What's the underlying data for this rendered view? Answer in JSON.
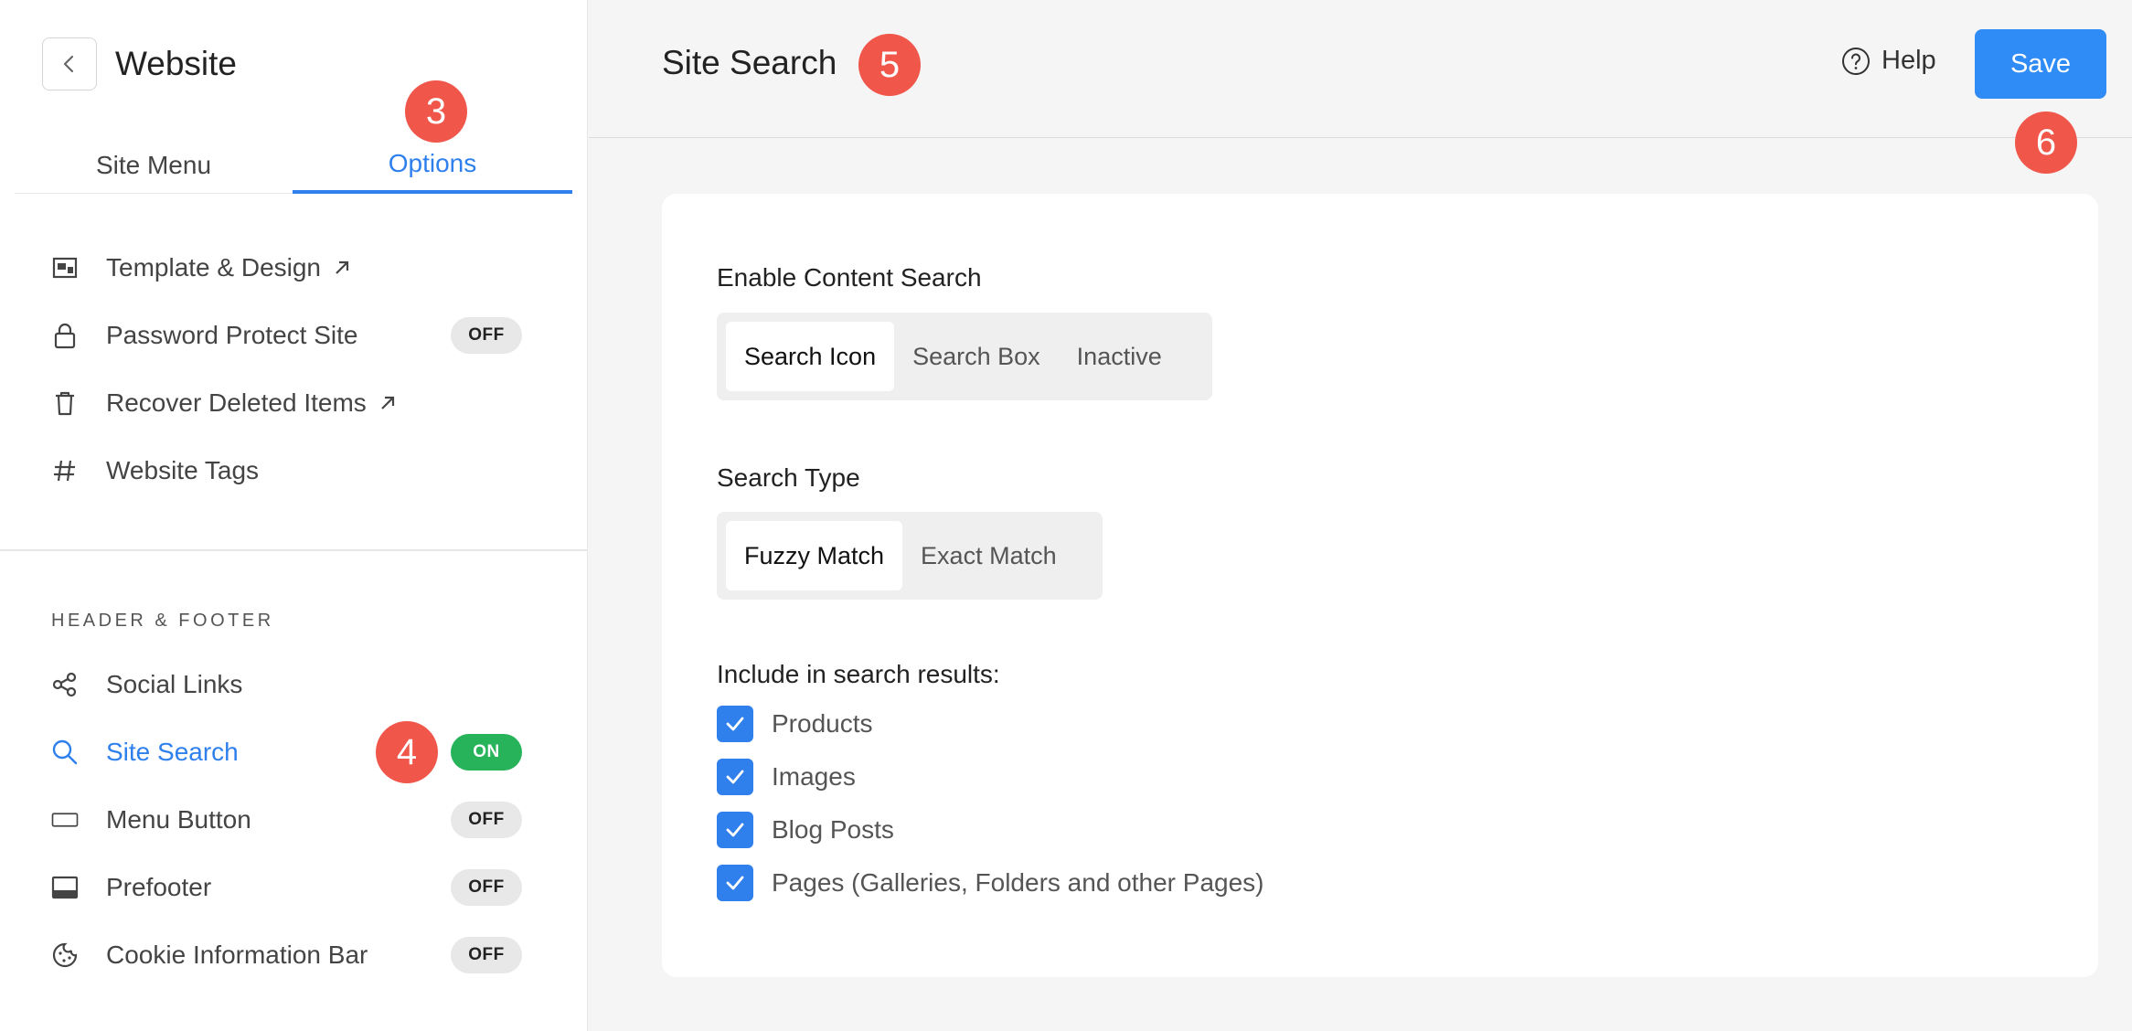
{
  "sidebar": {
    "title": "Website",
    "tabs": [
      {
        "label": "Site Menu",
        "active": false
      },
      {
        "label": "Options",
        "active": true
      }
    ],
    "options_items": [
      {
        "label": "Template & Design",
        "icon": "template-icon",
        "external": true
      },
      {
        "label": "Password Protect Site",
        "icon": "lock-icon",
        "toggle": "OFF"
      },
      {
        "label": "Recover Deleted Items",
        "icon": "trash-icon",
        "external": true
      },
      {
        "label": "Website Tags",
        "icon": "hash-icon"
      }
    ],
    "section_label": "HEADER & FOOTER",
    "header_footer_items": [
      {
        "label": "Social Links",
        "icon": "share-icon"
      },
      {
        "label": "Site Search",
        "icon": "search-icon",
        "toggle": "ON",
        "active": true
      },
      {
        "label": "Menu Button",
        "icon": "menu-button-icon",
        "toggle": "OFF"
      },
      {
        "label": "Prefooter",
        "icon": "prefooter-icon",
        "toggle": "OFF"
      },
      {
        "label": "Cookie Information Bar",
        "icon": "cookie-icon",
        "toggle": "OFF"
      }
    ]
  },
  "header": {
    "title": "Site Search",
    "help_label": "Help",
    "save_label": "Save"
  },
  "annotations": {
    "badge_3": "3",
    "badge_4": "4",
    "badge_5": "5",
    "badge_6": "6"
  },
  "form": {
    "content_search": {
      "label": "Enable Content Search",
      "options": [
        "Search Icon",
        "Search Box",
        "Inactive"
      ],
      "selected": "Search Icon"
    },
    "search_type": {
      "label": "Search Type",
      "options": [
        "Fuzzy Match",
        "Exact Match"
      ],
      "selected": "Fuzzy Match"
    },
    "include": {
      "label": "Include in search results:",
      "items": [
        {
          "label": "Products",
          "checked": true
        },
        {
          "label": "Images",
          "checked": true
        },
        {
          "label": "Blog Posts",
          "checked": true
        },
        {
          "label": "Pages (Galleries, Folders and other Pages)",
          "checked": true
        }
      ]
    }
  },
  "colors": {
    "accent": "#2f80ed",
    "badge": "#f0564a",
    "toggle_on": "#27b35a"
  }
}
